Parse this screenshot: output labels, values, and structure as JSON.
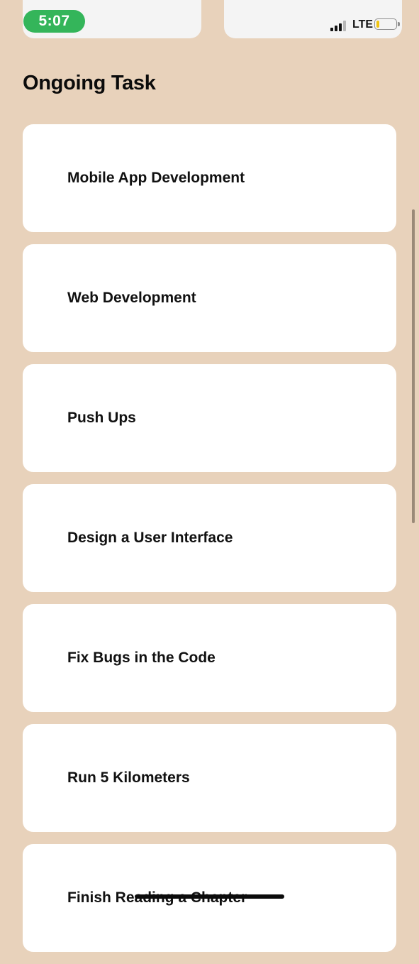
{
  "status_bar": {
    "time": "5:07",
    "network": "LTE",
    "battery_level": 0.15,
    "battery_color": "#f1c40f",
    "time_pill_color": "#34b55a"
  },
  "section": {
    "title": "Ongoing Task"
  },
  "tasks": [
    {
      "name": "Mobile App Development"
    },
    {
      "name": "Web Development"
    },
    {
      "name": "Push Ups"
    },
    {
      "name": "Design a User Interface"
    },
    {
      "name": "Fix Bugs in the Code"
    },
    {
      "name": "Run 5 Kilometers"
    },
    {
      "name": "Finish Reading a Chapter"
    }
  ],
  "colors": {
    "background": "#e8d2bb",
    "card": "#ffffff",
    "text": "#111111"
  }
}
